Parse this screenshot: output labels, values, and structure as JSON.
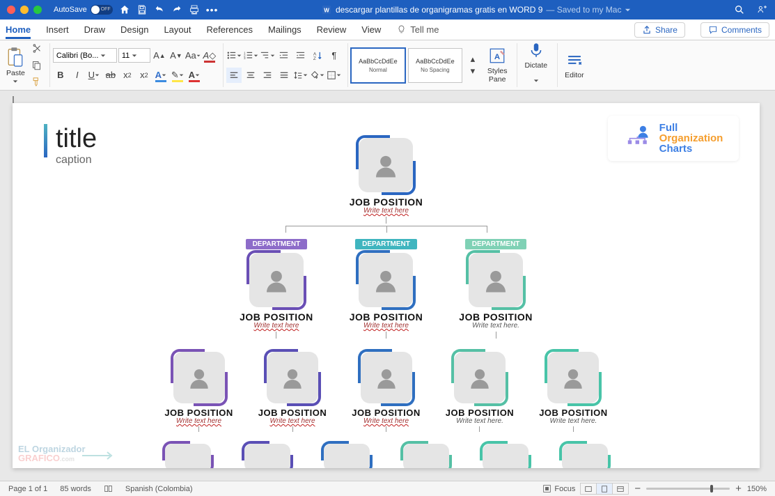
{
  "titlebar": {
    "autosave": "AutoSave",
    "switch": "OFF",
    "docname": "descargar plantillas de organigramas gratis en WORD 9",
    "saved": "— Saved to my Mac"
  },
  "tabs": [
    "Home",
    "Insert",
    "Draw",
    "Design",
    "Layout",
    "References",
    "Mailings",
    "Review",
    "View"
  ],
  "tellme": "Tell me",
  "share": "Share",
  "comments": "Comments",
  "ribbon": {
    "paste": "Paste",
    "font": "Calibri (Bo...",
    "size": "11",
    "normal": "Normal",
    "nospacing": "No Spacing",
    "preview": "AaBbCcDdEe",
    "stylesPane": "Styles\nPane",
    "dictate": "Dictate",
    "editor": "Editor"
  },
  "page": {
    "title": "title",
    "caption": "caption"
  },
  "logo": {
    "l1": "Full",
    "l2": "Organization",
    "l3": "Charts"
  },
  "chart": {
    "top": {
      "job": "JOB POSITION",
      "write": "Write text here"
    },
    "depts": [
      "DEPARTMENT",
      "DEPARTMENT",
      "DEPARTMENT"
    ],
    "row2": [
      {
        "job": "JOB POSITION",
        "write": "Write text here",
        "ac": "#6a4fb5",
        "wcred": true
      },
      {
        "job": "JOB POSITION",
        "write": "Write text here",
        "ac": "#2f6fc0",
        "wcred": true
      },
      {
        "job": "JOB POSITION",
        "write": "Write text here.",
        "ac": "#55c0a5",
        "wcred": false
      }
    ],
    "row3": [
      {
        "job": "JOB POSITION",
        "write": "Write text here",
        "ac": "#7a53b5",
        "wcred": true
      },
      {
        "job": "JOB POSITION",
        "write": "Write text here",
        "ac": "#5a4fb5",
        "wcred": true
      },
      {
        "job": "JOB POSITION",
        "write": "Write text here",
        "ac": "#2f6fc0",
        "wcred": true
      },
      {
        "job": "JOB POSITION",
        "write": "Write text here.",
        "ac": "#55c0a5",
        "wcred": false
      },
      {
        "job": "JOB POSITION",
        "write": "Write text here.",
        "ac": "#48c4a8",
        "wcred": false
      }
    ],
    "deptColors": [
      "#8d6cc9",
      "#3fb5bf",
      "#7fd1b5"
    ]
  },
  "status": {
    "page": "Page 1 of 1",
    "words": "85 words",
    "lang": "Spanish (Colombia)",
    "focus": "Focus",
    "zoom": "150%"
  }
}
